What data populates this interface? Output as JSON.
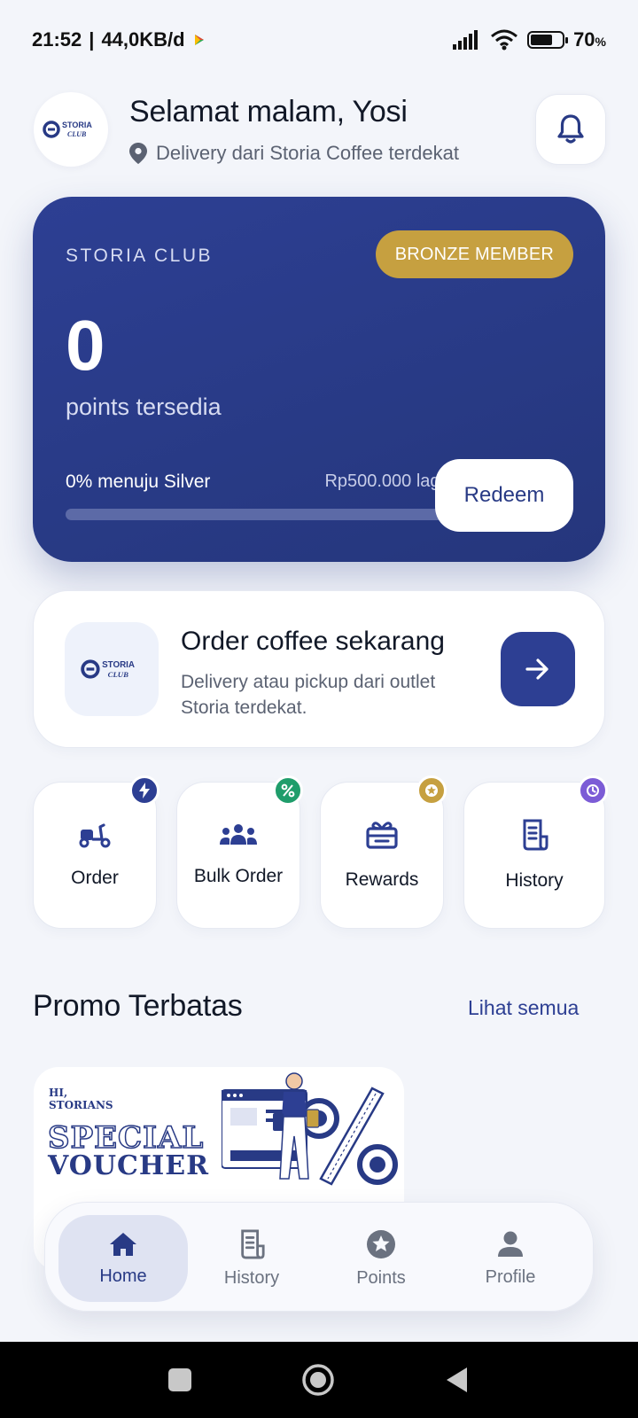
{
  "status_bar": {
    "time": "21:52",
    "separator": "|",
    "network_speed": "44,0KB/d",
    "battery_percent": "70",
    "battery_unit": "%",
    "battery_level": 0.7
  },
  "header": {
    "greeting": "Selamat malam, Yosi",
    "location": "Delivery dari Storia Coffee terdekat"
  },
  "brand": {
    "logo_line1": "STORIA",
    "logo_line2": "CLUB"
  },
  "membership": {
    "brand": "STORIA CLUB",
    "tier_badge": "BRONZE MEMBER",
    "points": "0",
    "points_label": "points tersedia",
    "progress_label": "0% menuju Silver",
    "progress_fraction": 0,
    "remaining": "Rp500.000 lagi",
    "redeem_label": "Redeem"
  },
  "order_card": {
    "title": "Order coffee sekarang",
    "description": "Delivery atau pickup dari outlet Storia terdekat."
  },
  "quick_menu": [
    {
      "label": "Order",
      "icon": "scooter-icon",
      "badge_icon": "lightning-icon"
    },
    {
      "label": "Bulk Order",
      "icon": "group-icon",
      "badge_icon": "percent-icon"
    },
    {
      "label": "Rewards",
      "icon": "gift-icon",
      "badge_icon": "star-icon"
    },
    {
      "label": "History",
      "icon": "receipt-icon",
      "badge_icon": "clock-icon"
    }
  ],
  "promo": {
    "title": "Promo Terbatas",
    "see_all": "Lihat semua",
    "banner_hi": "HI,",
    "banner_storians": "STORIANS",
    "banner_special": "SPECIAL",
    "banner_voucher": "VOUCHER"
  },
  "bottom_nav": [
    {
      "label": "Home",
      "icon": "home-icon",
      "active": true
    },
    {
      "label": "History",
      "icon": "receipt-icon",
      "active": false
    },
    {
      "label": "Points",
      "icon": "star-circle-icon",
      "active": false
    },
    {
      "label": "Profile",
      "icon": "person-icon",
      "active": false
    }
  ],
  "colors": {
    "primary": "#2d3f93",
    "gold": "#c6a040",
    "background": "#f3f5fa",
    "badge_green": "#1f9d6b",
    "badge_purple": "#7c5cd6"
  }
}
